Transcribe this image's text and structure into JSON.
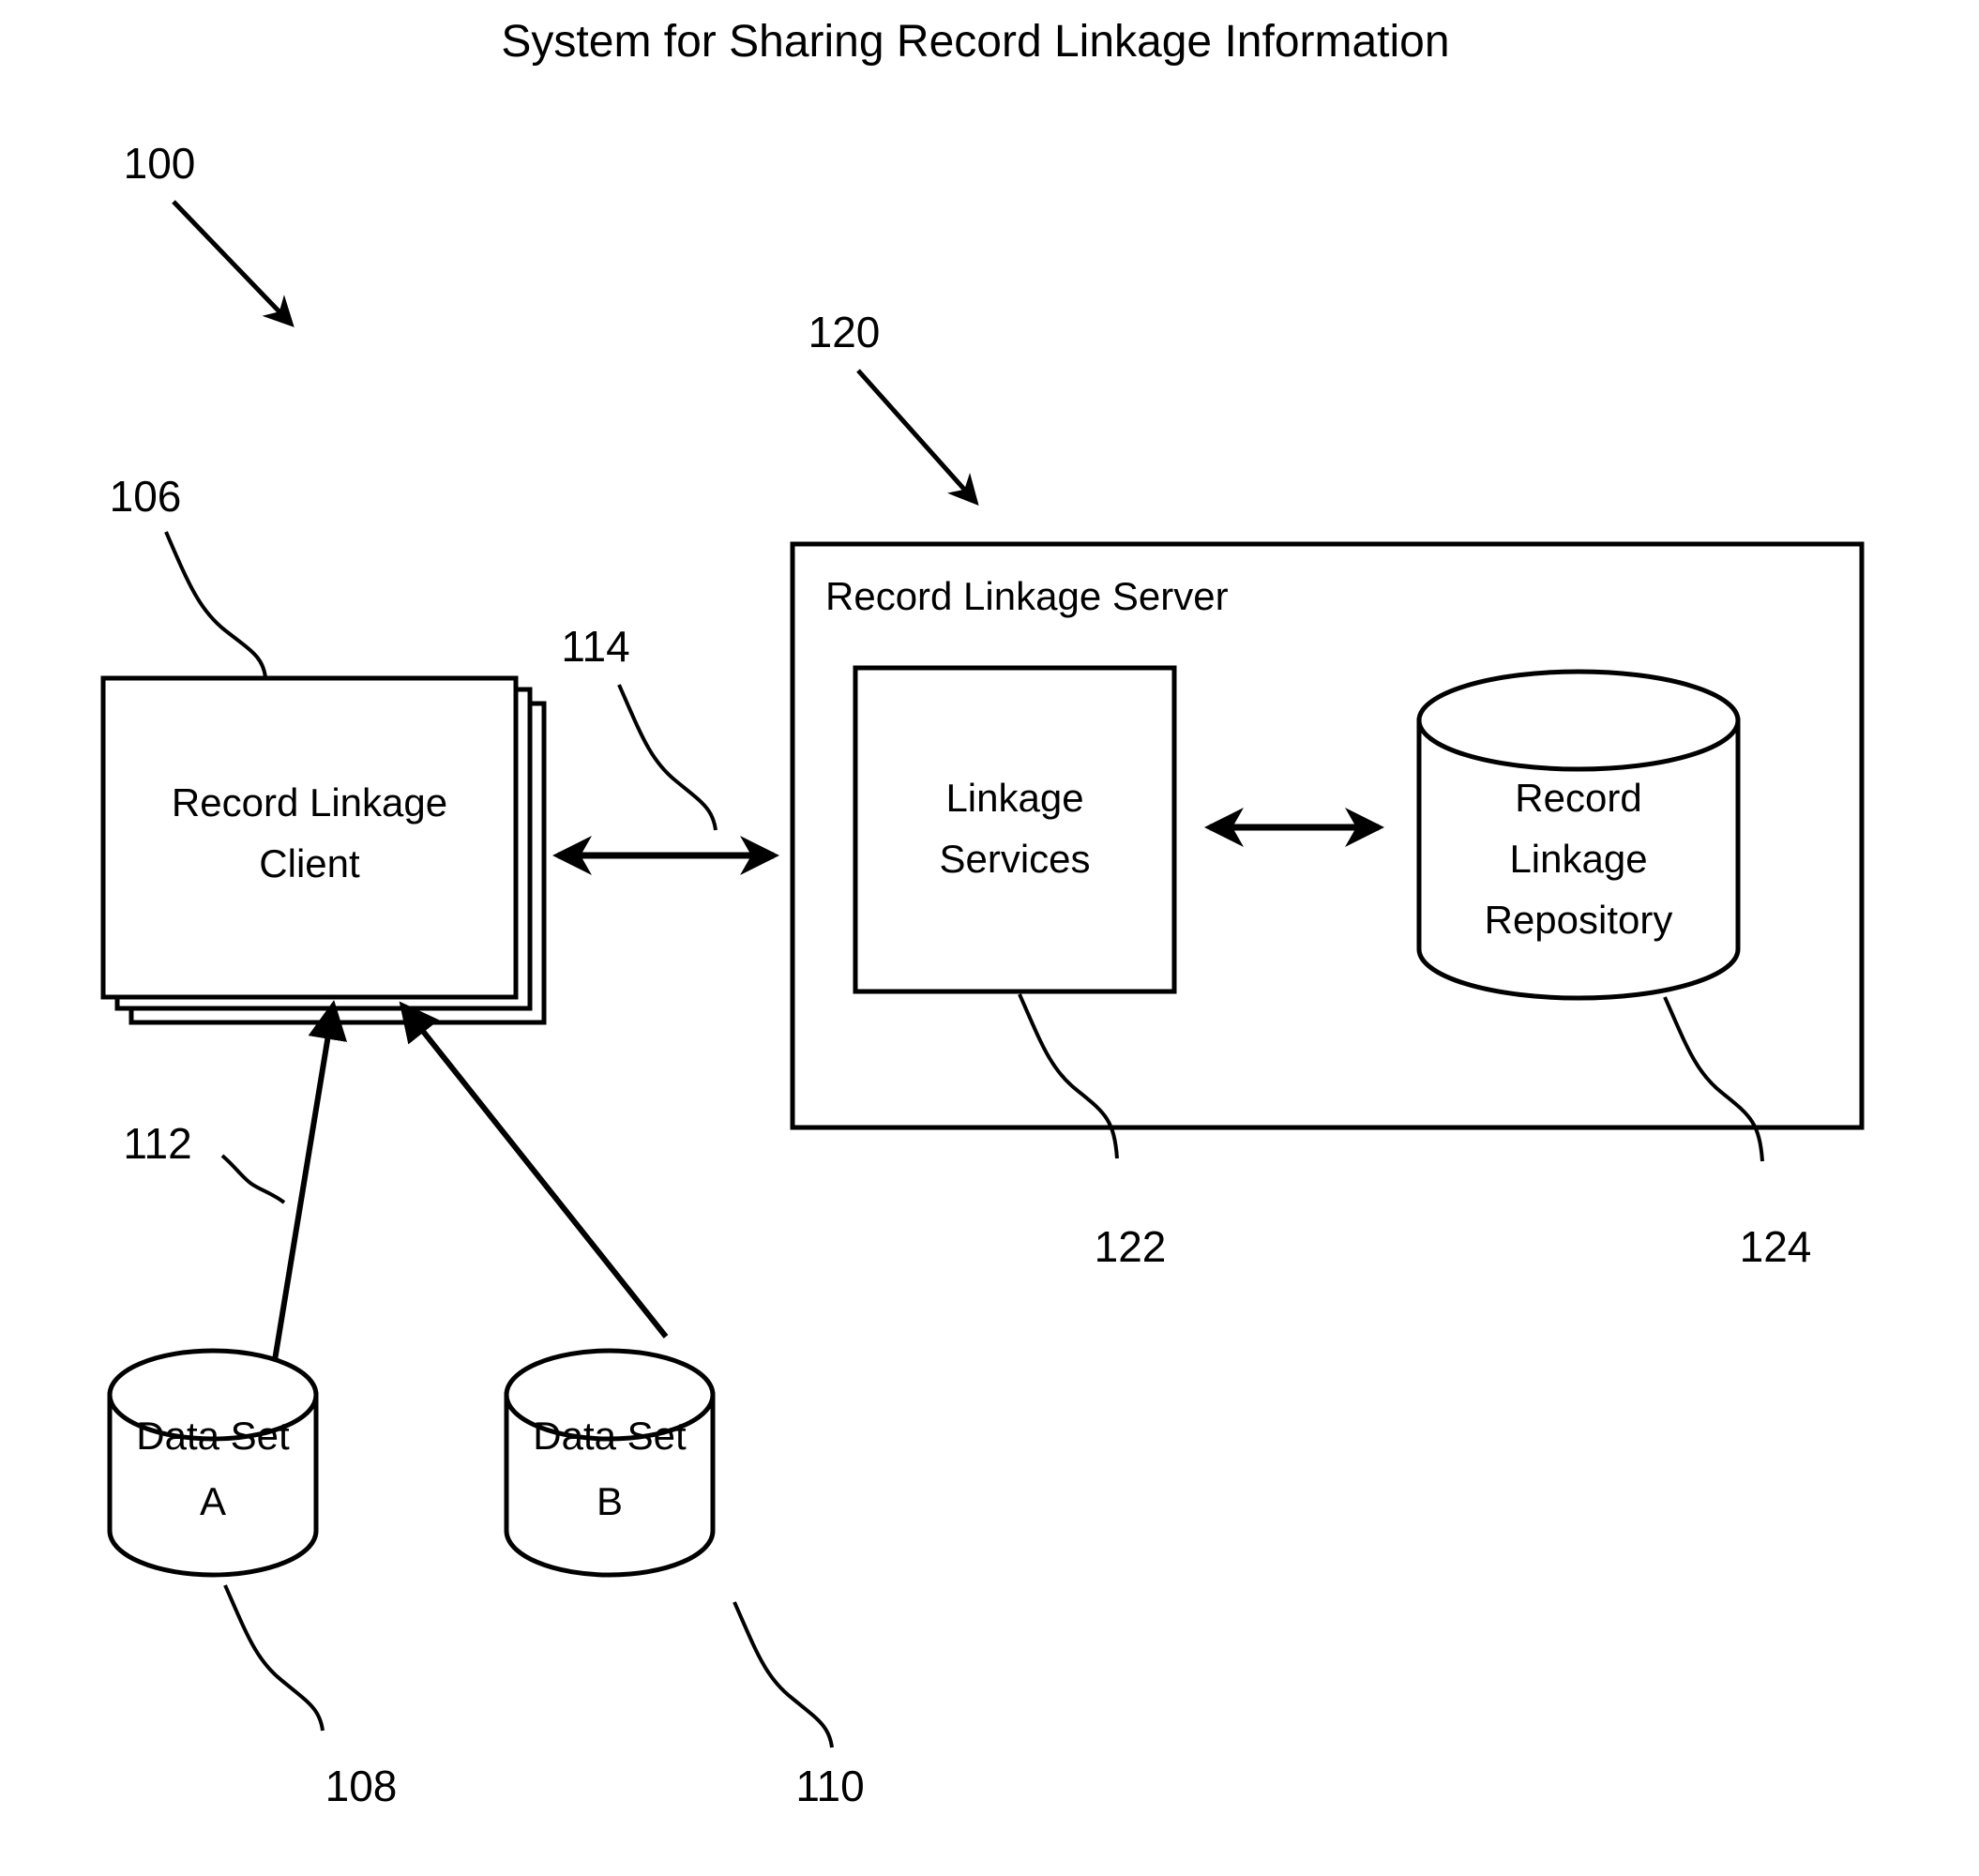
{
  "figure": {
    "title": "System for Sharing Record Linkage Information",
    "background_color": "#ffffff",
    "line_color": "#000000"
  },
  "nodes": {
    "client": {
      "label_line1": "Record Linkage",
      "label_line2": "Client",
      "shape": "stacked-rectangles",
      "stack_count": 3
    },
    "server": {
      "label": "Record Linkage Server",
      "shape": "rectangle"
    },
    "linkage_services": {
      "label_line1": "Linkage",
      "label_line2": "Services",
      "shape": "rectangle"
    },
    "repository": {
      "label_line1": "Record",
      "label_line2": "Linkage",
      "label_line3": "Repository",
      "shape": "cylinder"
    },
    "data_set_a": {
      "label_line1": "Data Set",
      "label_line2": "A",
      "shape": "cylinder"
    },
    "data_set_b": {
      "label_line1": "Data Set",
      "label_line2": "B",
      "shape": "cylinder"
    }
  },
  "reference_numerals": {
    "system": "100",
    "client": "106",
    "data_set_a": "108",
    "data_set_b": "110",
    "data_flow": "112",
    "client_server_link": "114",
    "server": "120",
    "linkage_services": "122",
    "repository": "124"
  },
  "connectors": {
    "client_to_server": {
      "type": "double-headed-arrow",
      "orientation": "horizontal"
    },
    "services_to_repository": {
      "type": "double-headed-arrow",
      "orientation": "horizontal"
    },
    "data_set_a_to_client": {
      "type": "single-headed-arrow",
      "orientation": "diagonal-up"
    },
    "data_set_b_to_client": {
      "type": "single-headed-arrow",
      "orientation": "diagonal-up"
    }
  }
}
